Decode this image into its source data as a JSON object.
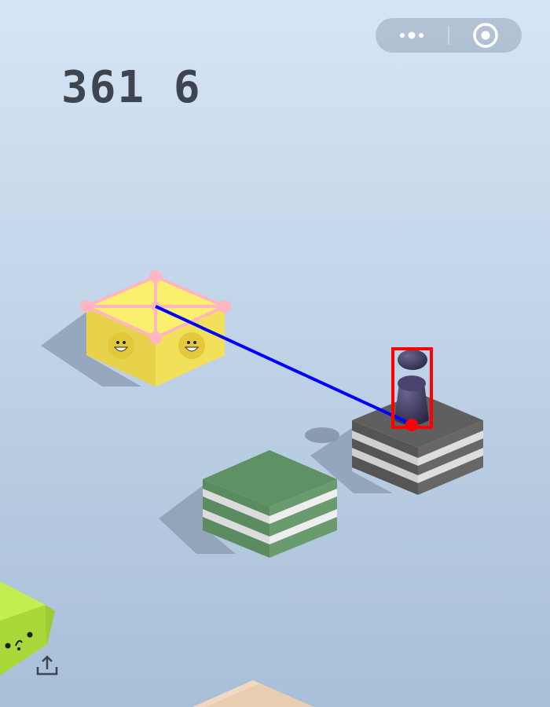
{
  "game": {
    "score": "361 6",
    "overlay_colors": {
      "target_outline": "#ffb6c1",
      "trajectory": "#0000ff",
      "player_box": "#ff0000"
    },
    "colors": {
      "background_top": "#d6e5f5",
      "background_bottom": "#a8bfd8",
      "yellow_block": "#f2df5a",
      "green_block": "#5f9366",
      "gray_block": "#5e5e5e",
      "lime_block": "#b5e63f",
      "wood_block": "#e8cdb0",
      "player": "#3c3658"
    }
  },
  "menu": {
    "more_icon": "more-dots-icon",
    "close_icon": "target-circle-icon"
  },
  "share": {
    "icon": "share-upload-icon"
  }
}
